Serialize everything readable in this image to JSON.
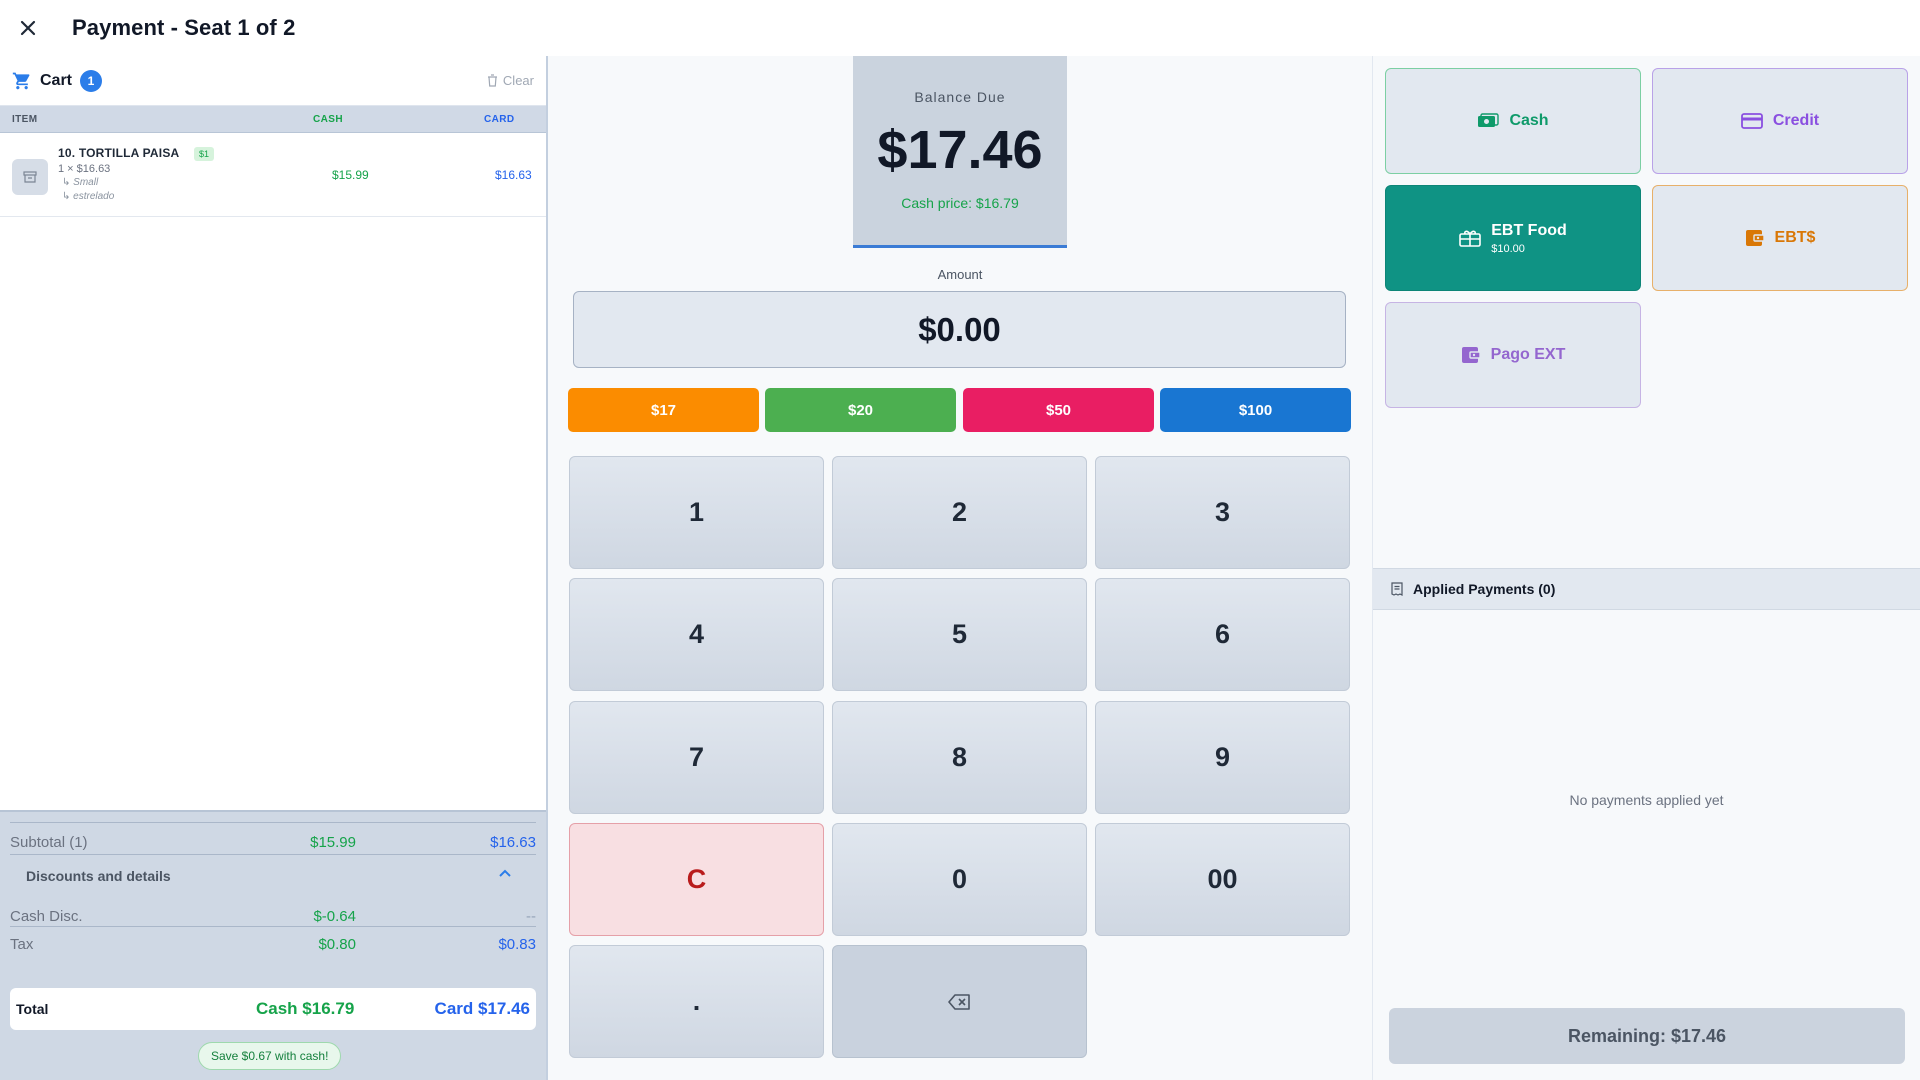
{
  "header": {
    "title": "Payment - Seat 1 of 2"
  },
  "cart": {
    "title": "Cart",
    "count": "1",
    "clear_label": "Clear",
    "columns": {
      "item": "ITEM",
      "cash": "CASH",
      "card": "CARD"
    },
    "items": [
      {
        "name": "10. TORTILLA PAISA",
        "badge": "$1",
        "qty_price": "1 × $16.63",
        "modifiers": [
          "↳ Small",
          "↳ estrelado"
        ],
        "cash": "$15.99",
        "card": "$16.63"
      }
    ],
    "summary": {
      "subtotal_label": "Subtotal (1)",
      "subtotal_cash": "$15.99",
      "subtotal_card": "$16.63",
      "discounts_label": "Discounts and details",
      "cash_disc_label": "Cash Disc.",
      "cash_disc_cash": "$-0.64",
      "cash_disc_card": "--",
      "tax_label": "Tax",
      "tax_cash": "$0.80",
      "tax_card": "$0.83",
      "total_label": "Total",
      "total_cash": "Cash $16.79",
      "total_card": "Card $17.46",
      "save_text": "Save $0.67 with cash!"
    }
  },
  "payment": {
    "balance_label": "Balance Due",
    "balance_value": "$17.46",
    "cash_price": "Cash price: $16.79",
    "amount_label": "Amount",
    "amount_value": "$0.00",
    "quick_amounts": [
      "$17",
      "$20",
      "$50",
      "$100"
    ],
    "quick_colors": [
      "#fb8c00",
      "#4caf50",
      "#e91e63",
      "#1976d2"
    ],
    "keys": [
      "1",
      "2",
      "3",
      "4",
      "5",
      "6",
      "7",
      "8",
      "9",
      "C",
      "0",
      "00",
      "."
    ]
  },
  "methods": {
    "cash": "Cash",
    "credit": "Credit",
    "ebt_food": "EBT Food",
    "ebt_food_balance": "$10.00",
    "ebt_cash": "EBT$",
    "pago_ext": "Pago EXT"
  },
  "applied": {
    "title": "Applied Payments (0)",
    "empty_text": "No payments applied yet",
    "remaining": "Remaining: $17.46"
  }
}
